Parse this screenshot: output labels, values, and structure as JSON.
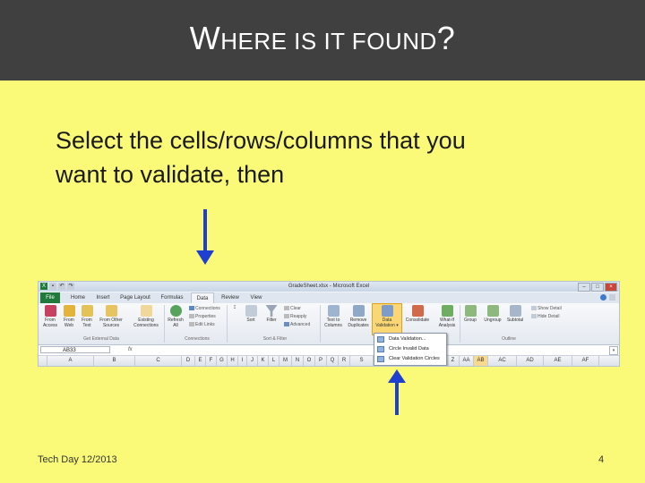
{
  "slide": {
    "title_first": "W",
    "title_rest": "HERE IS IT FOUND",
    "title_end": "?",
    "body_line1": "Select the cells/rows/columns that you",
    "body_line2": "want to validate, then",
    "footer_left": "Tech Day 12/2013",
    "footer_right": "4"
  },
  "colors": {
    "title_bar": "#404040",
    "background": "#fafa78",
    "arrow": "#1f3fd0"
  },
  "excel": {
    "window_title": "GradeSheet.xlsx - Microsoft Excel",
    "tabs": [
      "File",
      "Home",
      "Insert",
      "Page Layout",
      "Formulas",
      "Data",
      "Review",
      "View"
    ],
    "active_tab": "Data",
    "buttons": {
      "from_access": "From Access",
      "from_web": "From Web",
      "from_text": "From Text",
      "from_other": "From Other Sources",
      "existing": "Existing Connections",
      "refresh": "Refresh All",
      "sort": "Sort",
      "filter": "Filter",
      "text_to_columns": "Text to Columns",
      "remove_duplicates": "Remove Duplicates",
      "data_validation": "Data Validation",
      "consolidate": "Consolidate",
      "what_if": "What-If Analysis",
      "group": "Group",
      "ungroup": "Ungroup",
      "subtotal": "Subtotal"
    },
    "small_buttons": {
      "connections": "Connections",
      "properties": "Properties",
      "edit_links": "Edit Links",
      "clear": "Clear",
      "reapply": "Reapply",
      "advanced": "Advanced",
      "show_detail": "Show Detail",
      "hide_detail": "Hide Detail"
    },
    "groups": {
      "get_external": "Get External Data",
      "connections": "Connections",
      "sort_filter": "Sort & Filter",
      "outline": "Outline"
    },
    "name_box": "AB33",
    "fx_label": "fx",
    "columns": [
      "A",
      "B",
      "C",
      "D",
      "E",
      "F",
      "G",
      "H",
      "I",
      "J",
      "K",
      "L",
      "M",
      "N",
      "O",
      "P",
      "Q",
      "R",
      "S",
      "Z",
      "AA",
      "AB",
      "AC",
      "AD",
      "AE",
      "AF"
    ],
    "selected_column": "AB",
    "dropdown_items": [
      "Data Validation...",
      "Circle Invalid Data",
      "Clear Validation Circles"
    ]
  }
}
